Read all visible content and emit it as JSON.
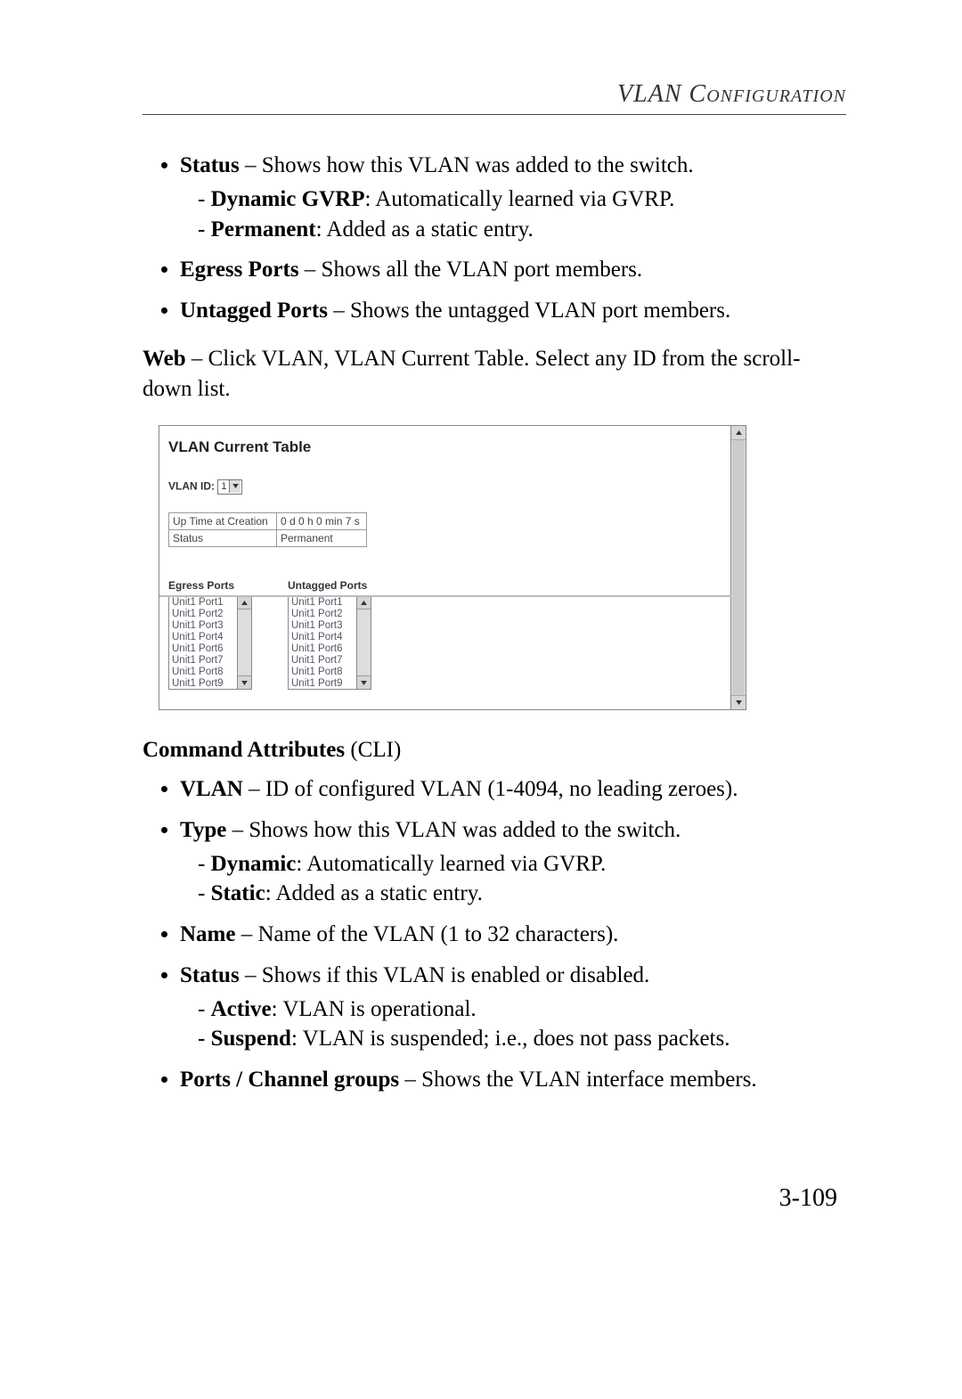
{
  "header": {
    "title_italic": "VLAN",
    "title_smallcaps": "Configuration"
  },
  "section1": {
    "items": [
      {
        "term": "Status",
        "desc": " – Shows how this VLAN was added to the switch.",
        "subs": [
          {
            "term": "Dynamic GVRP",
            "desc": ": Automatically learned via GVRP."
          },
          {
            "term": "Permanent",
            "desc": ": Added as a static entry."
          }
        ]
      },
      {
        "term": "Egress Ports",
        "desc": " – Shows all the VLAN port members."
      },
      {
        "term": "Untagged Ports",
        "desc": " – Shows the untagged VLAN port members."
      }
    ]
  },
  "web_para": {
    "bold": "Web",
    "text": " – Click VLAN, VLAN Current Table. Select any ID from the scroll-down list."
  },
  "screenshot": {
    "title": "VLAN Current Table",
    "vlan_id_label": "VLAN ID:",
    "vlan_id_value": "1",
    "info": [
      {
        "label": "Up Time at Creation",
        "value": "0 d 0 h 0 min 7 s"
      },
      {
        "label": "Status",
        "value": "Permanent"
      }
    ],
    "col1_head": "Egress Ports",
    "col2_head": "Untagged Ports",
    "ports": [
      "Unit1 Port1",
      "Unit1 Port2",
      "Unit1 Port3",
      "Unit1 Port4",
      "Unit1 Port6",
      "Unit1 Port7",
      "Unit1 Port8",
      "Unit1 Port9"
    ]
  },
  "cmd_attr": {
    "heading_bold": "Command Attributes",
    "heading_rest": " (CLI)",
    "items": [
      {
        "term": "VLAN",
        "desc": " – ID of configured VLAN (1-4094, no leading zeroes)."
      },
      {
        "term": "Type",
        "desc": " – Shows how this VLAN was added to the switch.",
        "subs": [
          {
            "term": "Dynamic",
            "desc": ": Automatically learned via GVRP."
          },
          {
            "term": "Static",
            "desc": ": Added as a static entry."
          }
        ]
      },
      {
        "term": "Name",
        "desc": " – Name of the VLAN (1 to 32 characters)."
      },
      {
        "term": "Status",
        "desc": " – Shows if this VLAN is enabled or disabled.",
        "subs": [
          {
            "term": "Active",
            "desc": ": VLAN is operational."
          },
          {
            "term": "Suspend",
            "desc": ": VLAN is suspended; i.e., does not pass packets."
          }
        ]
      },
      {
        "term": "Ports / Channel groups",
        "desc": " – Shows the VLAN interface members."
      }
    ]
  },
  "page_number": "3-109"
}
